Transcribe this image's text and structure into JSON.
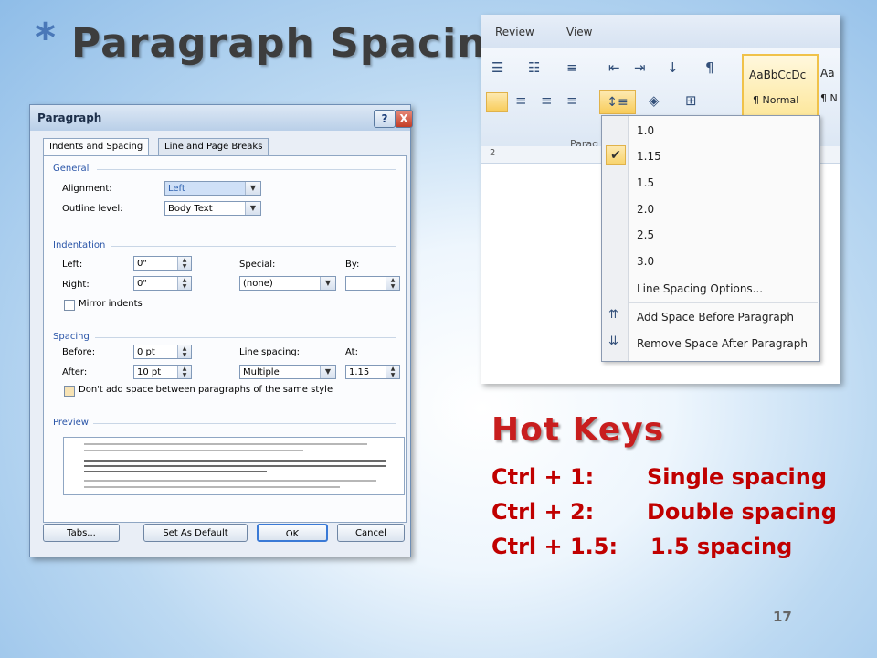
{
  "slide": {
    "star": "*",
    "title": "Paragraph Spacing",
    "page_number": "17"
  },
  "dialog": {
    "title": "Paragraph",
    "help_label": "?",
    "close_label": "X",
    "tabs": [
      "Indents and Spacing",
      "Line and Page Breaks"
    ],
    "general": {
      "heading": "General",
      "alignment_label": "Alignment:",
      "alignment_value": "Left",
      "outline_label": "Outline level:",
      "outline_value": "Body Text"
    },
    "indentation": {
      "heading": "Indentation",
      "left_label": "Left:",
      "left_value": "0\"",
      "right_label": "Right:",
      "right_value": "0\"",
      "special_label": "Special:",
      "special_value": "(none)",
      "by_label": "By:",
      "by_value": "",
      "mirror_label": "Mirror indents"
    },
    "spacing": {
      "heading": "Spacing",
      "before_label": "Before:",
      "before_value": "0 pt",
      "after_label": "After:",
      "after_value": "10 pt",
      "line_spacing_label": "Line spacing:",
      "line_spacing_value": "Multiple",
      "at_label": "At:",
      "at_value": "1.15",
      "dont_add_label": "Don't add space between paragraphs of the same style"
    },
    "preview_heading": "Preview",
    "buttons": {
      "tabs": "Tabs...",
      "set_default": "Set As Default",
      "ok": "OK",
      "cancel": "Cancel"
    }
  },
  "ribbon": {
    "tabs": [
      "Review",
      "View"
    ],
    "style_normal_sample": "AaBbCcDc",
    "style_normal_label": "¶ Normal",
    "style_next_sample": "Aa",
    "style_next_label": "¶ N",
    "group_label": "Parag",
    "ruler_mark": "2",
    "line_spacing_menu": {
      "items": [
        "1.0",
        "1.15",
        "1.5",
        "2.0",
        "2.5",
        "3.0"
      ],
      "checked": "1.15",
      "options": "Line Spacing Options...",
      "add_space": "Add Space Before Paragraph",
      "remove_space": "Remove Space After Paragraph"
    }
  },
  "hotkeys": {
    "title": "Hot Keys",
    "rows": [
      {
        "key": "Ctrl + 1:",
        "action": "Single spacing"
      },
      {
        "key": "Ctrl + 2:",
        "action": "Double spacing"
      },
      {
        "key": "Ctrl + 1.5:",
        "action": "1.5 spacing"
      }
    ]
  },
  "colors": {
    "title_text": "#3d3d3d",
    "star": "#4a78b8",
    "hotkeys": "#c00000",
    "dialog_bg": "#e9eef6"
  }
}
